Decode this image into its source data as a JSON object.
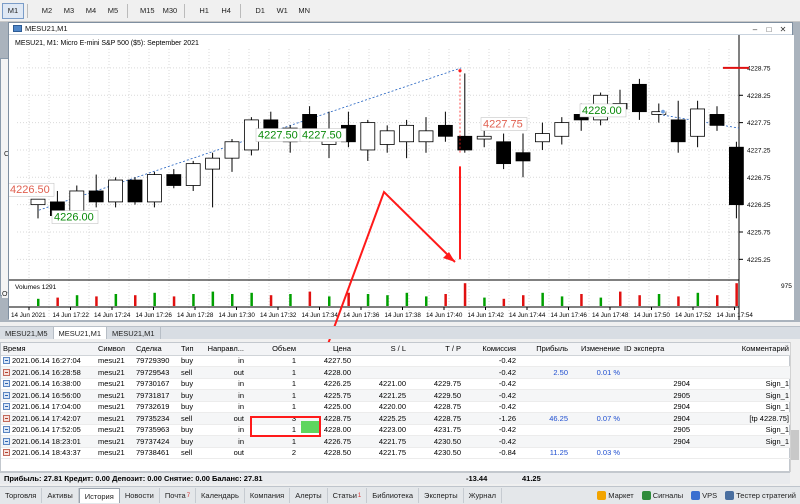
{
  "toolbar": {
    "timeframes": [
      "M1",
      "M2",
      "M3",
      "M4",
      "M5",
      "M15",
      "M30",
      "H1",
      "H4",
      "D1",
      "W1",
      "MN"
    ],
    "active": "M1"
  },
  "left_window": {
    "label": "Сим",
    "label2": "Ot"
  },
  "chart": {
    "window_title": "MESU21,M1",
    "info": "MESU21, M1:  Micro E-mini S&P 500 ($5): September 2021",
    "price_labels": [
      "4228.75",
      "4228.25",
      "4227.75",
      "4227.25",
      "4226.75",
      "4226.25",
      "4225.75",
      "4225.25"
    ],
    "current_price_label": "4228.75",
    "volume_label": "Volumes 1291",
    "volume_scale": "975",
    "time_labels": [
      "14 Jun 2021",
      "14 Jun 17:22",
      "14 Jun 17:24",
      "14 Jun 17:26",
      "14 Jun 17:28",
      "14 Jun 17:30",
      "14 Jun 17:32",
      "14 Jun 17:34",
      "14 Jun 17:36",
      "14 Jun 17:38",
      "14 Jun 17:40",
      "14 Jun 17:42",
      "14 Jun 17:44",
      "14 Jun 17:46",
      "14 Jun 17:48",
      "14 Jun 17:50",
      "14 Jun 17:52",
      "14 Jun 17:54"
    ],
    "trade_labels": [
      "4226.00",
      "4227.50",
      "4227.50",
      "4227.75",
      "4228.00",
      "4226.50"
    ],
    "colors": {
      "up_candle": "#ffffff",
      "down_candle": "#000000",
      "vol_up": "#00a000",
      "vol_down": "#e01010",
      "annotation": "#ff1a1a",
      "trendline": "#2060c0"
    }
  },
  "chart_tabs": [
    "MESU21,M5",
    "MESU21,M1",
    "MESU21,M1"
  ],
  "chart_tab_active": 1,
  "table": {
    "columns": [
      "Время",
      "Символ",
      "Сделка",
      "Тип",
      "Направл...",
      "Объем",
      "Цена",
      "S / L",
      "T / P",
      "Комиссия",
      "Прибыль",
      "Изменение",
      "ID эксперта",
      "Комментарий"
    ],
    "rows": [
      {
        "time": "2021.06.14 16:27:04",
        "symbol": "mesu21",
        "deal": "79729390",
        "type": "buy",
        "dir": "in",
        "vol": "1",
        "price": "4227.50",
        "sl": "",
        "tp": "",
        "comm": "-0.42",
        "profit": "",
        "change": "",
        "expert": "",
        "comment": "",
        "side": "buy"
      },
      {
        "time": "2021.06.14 16:28:58",
        "symbol": "mesu21",
        "deal": "79729543",
        "type": "sell",
        "dir": "out",
        "vol": "1",
        "price": "4228.00",
        "sl": "",
        "tp": "",
        "comm": "-0.42",
        "profit": "2.50",
        "change": "0.01 %",
        "expert": "",
        "comment": "",
        "side": "sell"
      },
      {
        "time": "2021.06.14 16:38:00",
        "symbol": "mesu21",
        "deal": "79730167",
        "type": "buy",
        "dir": "in",
        "vol": "1",
        "price": "4226.25",
        "sl": "4221.00",
        "tp": "4229.75",
        "comm": "-0.42",
        "profit": "",
        "change": "",
        "expert": "2904",
        "comment": "Sign_1",
        "side": "buy"
      },
      {
        "time": "2021.06.14 16:56:00",
        "symbol": "mesu21",
        "deal": "79731817",
        "type": "buy",
        "dir": "in",
        "vol": "1",
        "price": "4225.75",
        "sl": "4221.25",
        "tp": "4229.50",
        "comm": "-0.42",
        "profit": "",
        "change": "",
        "expert": "2905",
        "comment": "Sign_1",
        "side": "buy"
      },
      {
        "time": "2021.06.14 17:04:00",
        "symbol": "mesu21",
        "deal": "79732619",
        "type": "buy",
        "dir": "in",
        "vol": "1",
        "price": "4225.00",
        "sl": "4220.00",
        "tp": "4228.75",
        "comm": "-0.42",
        "profit": "",
        "change": "",
        "expert": "2904",
        "comment": "Sign_1",
        "side": "buy"
      },
      {
        "time": "2021.06.14 17:42:07",
        "symbol": "mesu21",
        "deal": "79735234",
        "type": "sell",
        "dir": "out",
        "vol": "3",
        "price": "4228.75",
        "sl": "4225.25",
        "tp": "4228.75",
        "comm": "-1.26",
        "profit": "46.25",
        "change": "0.07 %",
        "expert": "2904",
        "comment": "[tp 4228.75]",
        "side": "sell"
      },
      {
        "time": "2021.06.14 17:52:05",
        "symbol": "mesu21",
        "deal": "79735963",
        "type": "buy",
        "dir": "in",
        "vol": "1",
        "price": "4228.00",
        "sl": "4223.00",
        "tp": "4231.75",
        "comm": "-0.42",
        "profit": "",
        "change": "",
        "expert": "2905",
        "comment": "Sign_1",
        "side": "buy"
      },
      {
        "time": "2021.06.14 18:23:01",
        "symbol": "mesu21",
        "deal": "79737424",
        "type": "buy",
        "dir": "in",
        "vol": "1",
        "price": "4226.75",
        "sl": "4221.75",
        "tp": "4230.50",
        "comm": "-0.42",
        "profit": "",
        "change": "",
        "expert": "2904",
        "comment": "Sign_1",
        "side": "buy"
      },
      {
        "time": "2021.06.14 18:43:37",
        "symbol": "mesu21",
        "deal": "79738461",
        "type": "sell",
        "dir": "out",
        "vol": "2",
        "price": "4228.50",
        "sl": "4221.75",
        "tp": "4230.50",
        "comm": "-0.84",
        "profit": "11.25",
        "change": "0.03 %",
        "expert": "",
        "comment": "",
        "side": "sell"
      }
    ]
  },
  "summary": {
    "text": "Прибыль: 27.81  Кредит: 0.00  Депозит: 0.00  Снятие: 0.00  Баланс: 27.81",
    "commission_total": "-13.44",
    "profit_total": "41.25"
  },
  "bottom_tabs": [
    {
      "label": "Торговля",
      "badge": ""
    },
    {
      "label": "Активы",
      "badge": ""
    },
    {
      "label": "История",
      "badge": ""
    },
    {
      "label": "Новости",
      "badge": ""
    },
    {
      "label": "Почта",
      "badge": "7"
    },
    {
      "label": "Календарь",
      "badge": ""
    },
    {
      "label": "Компания",
      "badge": ""
    },
    {
      "label": "Алерты",
      "badge": ""
    },
    {
      "label": "Статьи",
      "badge": "1"
    },
    {
      "label": "Библиотека",
      "badge": ""
    },
    {
      "label": "Эксперты",
      "badge": ""
    },
    {
      "label": "Журнал",
      "badge": ""
    }
  ],
  "bottom_tab_active": 2,
  "right_tools": [
    {
      "label": "Маркет",
      "icon": "market-icon",
      "color": "#f2a400"
    },
    {
      "label": "Сигналы",
      "icon": "signals-icon",
      "color": "#2e8b3a"
    },
    {
      "label": "VPS",
      "icon": "vps-icon",
      "color": "#3a6fd0"
    },
    {
      "label": "Тестер стратегий",
      "icon": "tester-icon",
      "color": "#4a6fa0"
    }
  ]
}
